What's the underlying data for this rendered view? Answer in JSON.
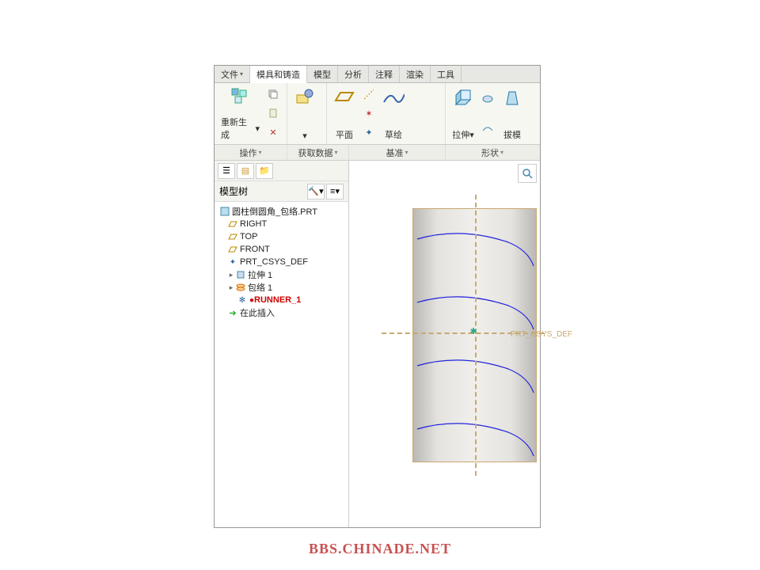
{
  "menu": {
    "file": "文件",
    "active": "模具和铸造",
    "others": [
      "模型",
      "分析",
      "注释",
      "渲染",
      "工具"
    ]
  },
  "ribbon": {
    "regen": "重新生成",
    "plane": "平面",
    "sketch": "草绘",
    "extrude": "拉伸",
    "draft": "拔模"
  },
  "panels": {
    "p1": "操作",
    "p2": "获取数据",
    "p3": "基准",
    "p4": "形状"
  },
  "tree_header": "模型树",
  "tree": {
    "root": "圆柱倒圆角_包络.PRT",
    "right": "RIGHT",
    "top": "TOP",
    "front": "FRONT",
    "csys": "PRT_CSYS_DEF",
    "extrude1": "拉伸 1",
    "envelope1": "包络 1",
    "runner": "RUNNER_1",
    "insert": "在此插入"
  },
  "csys_label": "PRT_CSYS_DEF",
  "watermark": "BBS.CHINADE.NET"
}
